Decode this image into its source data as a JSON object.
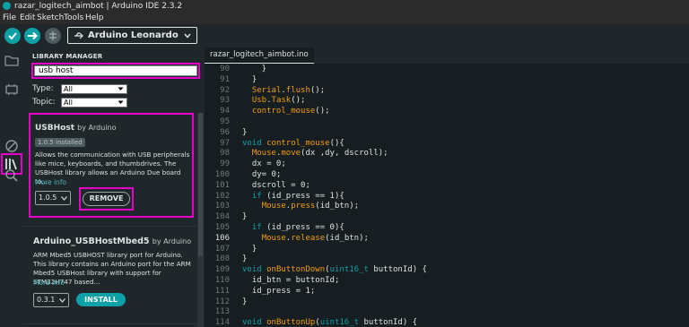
{
  "window": {
    "title": "razar_logitech_aimbot | Arduino IDE 2.3.2"
  },
  "menu": [
    "File",
    "Edit",
    "Sketch",
    "Tools",
    "Help"
  ],
  "toolbar": {
    "board": "Arduino Leonardo",
    "icons": [
      "verify-icon",
      "upload-icon",
      "debug-icon",
      "usb-icon",
      "chevron-down-icon"
    ]
  },
  "library_manager": {
    "title": "LIBRARY MANAGER",
    "search_value": "usb host",
    "type_label": "Type:",
    "type_value": "All",
    "topic_label": "Topic:",
    "topic_value": "All",
    "results": [
      {
        "name": "USBHost",
        "author": "by Arduino",
        "installed_badge": "1.0.5 installed",
        "description_lines": [
          "Allows the communication with USB peripherals",
          "like mice, keyboards, and thumbdrives. The",
          "USBHost library allows an Arduino Due board to..."
        ],
        "more_info": "More info",
        "version": "1.0.5",
        "action": "REMOVE"
      },
      {
        "name": "Arduino_USBHostMbed5",
        "author": "by Arduino",
        "description_lines": [
          "ARM Mbed5 USBHOST library port for Arduino.",
          "This library contains an Arduino port for the ARM",
          "Mbed5 USBHost library with support for STM32H747 based..."
        ],
        "more_info": "More info",
        "version": "0.3.1",
        "action": "INSTALL"
      }
    ]
  },
  "editor": {
    "tab": "razar_logitech_aimbot.ino",
    "current_line": 106,
    "lines": [
      {
        "n": "90",
        "code": "    }"
      },
      {
        "n": "91",
        "code": "  }"
      },
      {
        "n": "92",
        "code": "  Serial.flush();"
      },
      {
        "n": "93",
        "code": "  Usb.Task();"
      },
      {
        "n": "94",
        "code": "  control_mouse();"
      },
      {
        "n": "95",
        "code": ""
      },
      {
        "n": "96",
        "code": "}"
      },
      {
        "n": "97",
        "code": "void control_mouse(){"
      },
      {
        "n": "98",
        "code": "  Mouse.move(dx ,dy, dscroll);"
      },
      {
        "n": "99",
        "code": "  dx = 0;"
      },
      {
        "n": "100",
        "code": "  dy= 0;"
      },
      {
        "n": "101",
        "code": "  dscroll = 0;"
      },
      {
        "n": "102",
        "code": "  if (id_press == 1){"
      },
      {
        "n": "103",
        "code": "    Mouse.press(id_btn);"
      },
      {
        "n": "104",
        "code": "}"
      },
      {
        "n": "105",
        "code": "  if (id_press == 0){"
      },
      {
        "n": "106",
        "code": "    Mouse.release(id_btn);"
      },
      {
        "n": "107",
        "code": "  }"
      },
      {
        "n": "108",
        "code": "}"
      },
      {
        "n": "109",
        "code": "void onButtonDown(uint16_t buttonId) {"
      },
      {
        "n": "110",
        "code": "  id_btn = buttonId;"
      },
      {
        "n": "111",
        "code": "  id_press = 1;"
      },
      {
        "n": "112",
        "code": "}"
      },
      {
        "n": "113",
        "code": ""
      },
      {
        "n": "114",
        "code": "void onButtonUp(uint16_t buttonId) {"
      }
    ]
  },
  "colors": {
    "accent": "#0ca1a6",
    "highlight": "#e600c9",
    "function": "#f39c12"
  }
}
